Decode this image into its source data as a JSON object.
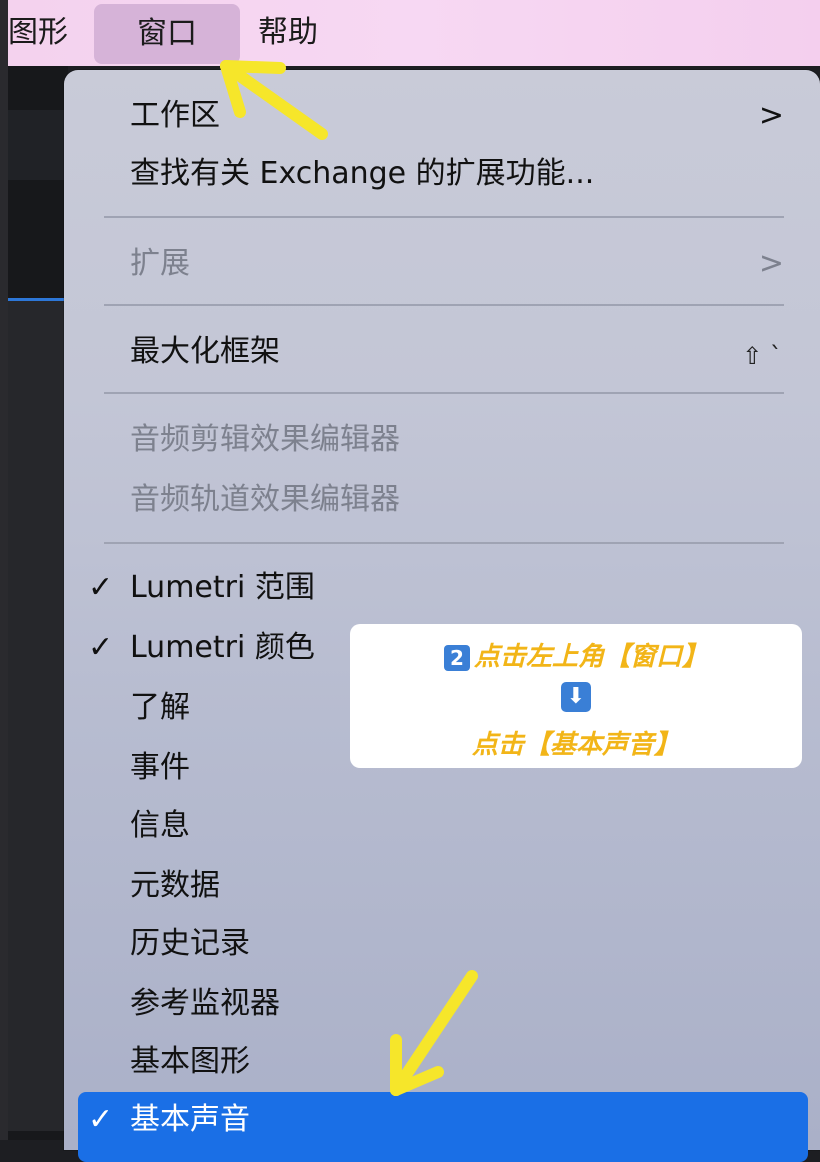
{
  "menubar": {
    "items": [
      {
        "label": "图形"
      },
      {
        "label": "窗口"
      },
      {
        "label": "帮助"
      }
    ]
  },
  "menu": {
    "workspace": "工作区",
    "find_exchange": "查找有关 Exchange 的扩展功能...",
    "extensions": "扩展",
    "maximize_frame": "最大化框架",
    "maximize_shortcut": "⇧ `",
    "audio_clip_effect_editor": "音频剪辑效果编辑器",
    "audio_track_effect_editor": "音频轨道效果编辑器",
    "lumetri_scopes": "Lumetri 范围",
    "lumetri_color": "Lumetri 颜色",
    "learn": "了解",
    "events": "事件",
    "info": "信息",
    "metadata": "元数据",
    "history": "历史记录",
    "reference_monitor": "参考监视器",
    "essential_graphics": "基本图形",
    "essential_sound": "基本声音",
    "check_mark": "✓",
    "submenu_arrow": ">"
  },
  "callout": {
    "step_number": "2",
    "line1": "点击左上角【窗口】",
    "down_arrow": "⬇",
    "line2": "点击【基本声音】"
  },
  "colors": {
    "menubar": "#f4d2ee",
    "selection": "#1a6fe6",
    "annotation_arrow": "#f6e62a",
    "callout_text": "#f2b518"
  }
}
